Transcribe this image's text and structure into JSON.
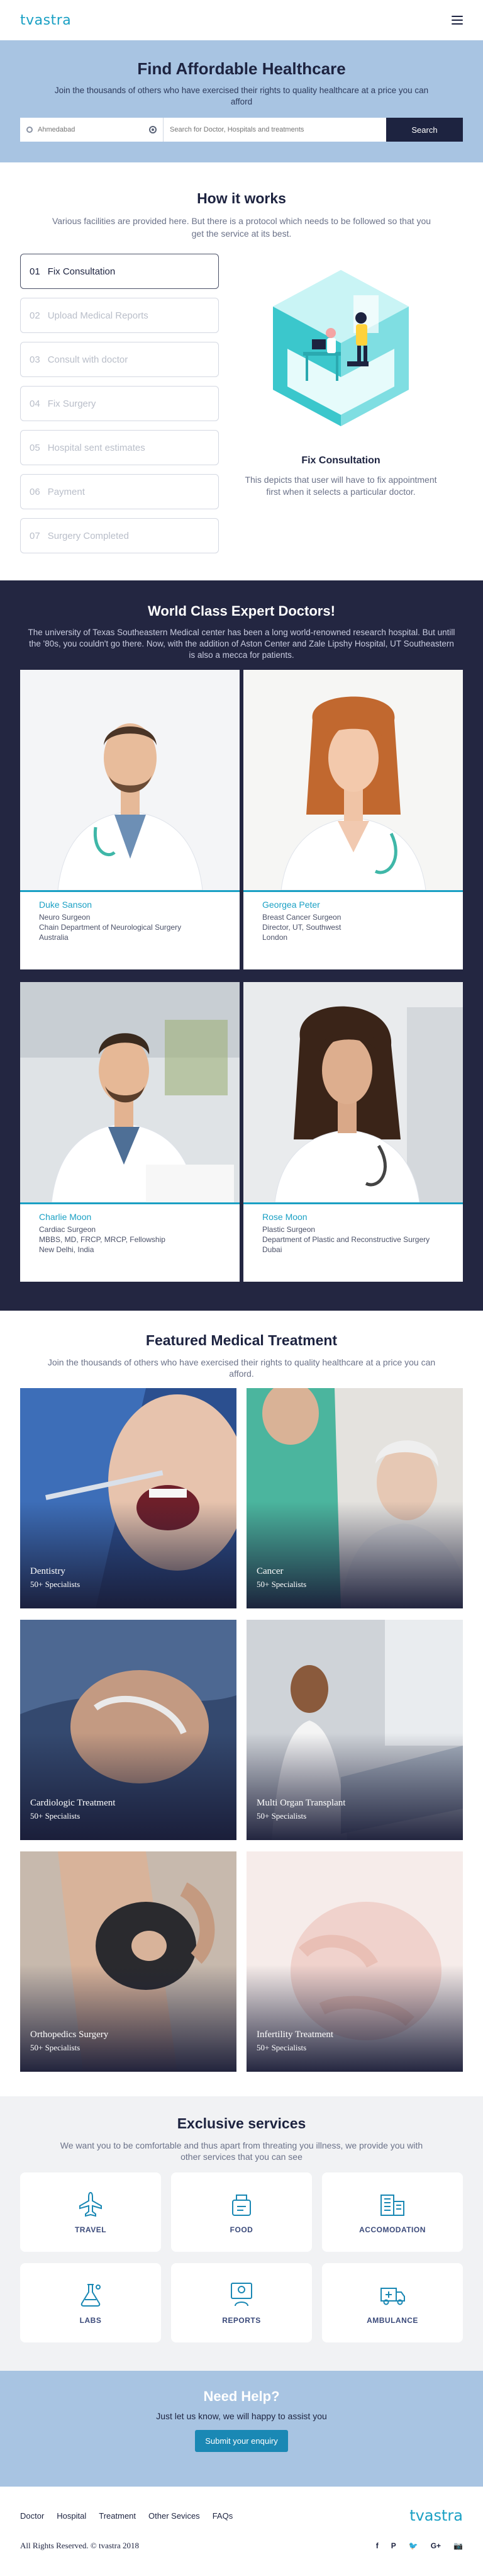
{
  "header": {
    "logo": "tvastra",
    "menu_icon": "hamburger-icon"
  },
  "hero": {
    "title": "Find Affordable Healthcare",
    "subtitle": "Join the thousands of others who have exercised their rights to quality healthcare at a price you can afford",
    "location_placeholder": "Ahmedabad",
    "search_placeholder": "Search for Doctor, Hospitals and treatments",
    "search_button": "Search"
  },
  "how": {
    "title": "How it works",
    "subtitle": "Various facilities are provided here. But there is a protocol which needs to be followed so that you get the service at its best.",
    "steps": [
      {
        "num": "01",
        "label": "Fix Consultation"
      },
      {
        "num": "02",
        "label": "Upload Medical Reports"
      },
      {
        "num": "03",
        "label": "Consult with doctor"
      },
      {
        "num": "04",
        "label": "Fix Surgery"
      },
      {
        "num": "05",
        "label": "Hospital sent estimates"
      },
      {
        "num": "06",
        "label": "Payment"
      },
      {
        "num": "07",
        "label": "Surgery Completed"
      }
    ],
    "active_step": 0,
    "detail_title": "Fix Consultation",
    "detail_text": "This depicts that user will have to fix appointment first when it selects a particular doctor."
  },
  "doctors": {
    "title": "World Class Expert Doctors!",
    "subtitle": "The university of Texas Southeastern Medical center has been a long world-renowned research hospital. But untill the '80s, you couldn't go there. Now, with the addition of Aston Center and Zale Lipshy Hospital, UT Southeastern is also a mecca for patients.",
    "list": [
      {
        "name": "Duke Sanson",
        "lines": [
          "Neuro Surgeon",
          "Chain Department of Neurological Surgery",
          "Australia"
        ]
      },
      {
        "name": "Georgea Peter",
        "lines": [
          "Breast Cancer Surgeon",
          "Director, UT, Southwest",
          "London"
        ]
      },
      {
        "name": "Charlie Moon",
        "lines": [
          "Cardiac Surgeon",
          "MBBS, MD, FRCP, MRCP, Fellowship",
          "New Delhi, India"
        ]
      },
      {
        "name": "Rose Moon",
        "lines": [
          "Plastic Surgeon",
          "Department of Plastic and Reconstructive Surgery",
          "Dubai"
        ]
      }
    ]
  },
  "treatment": {
    "title": "Featured Medical Treatment",
    "subtitle": "Join the thousands of others who have exercised their rights to quality healthcare at a price you can afford.",
    "cards": [
      {
        "name": "Dentistry",
        "count": "50+ Specialists"
      },
      {
        "name": "Cancer",
        "count": "50+ Specialists"
      },
      {
        "name": "Cardiologic Treatment",
        "count": "50+ Specialists"
      },
      {
        "name": "Multi Organ Transplant",
        "count": "50+ Specialists"
      },
      {
        "name": "Orthopedics Surgery",
        "count": "50+ Specialists"
      },
      {
        "name": "Infertility Treatment",
        "count": "50+ Specialists"
      }
    ]
  },
  "services": {
    "title": "Exclusive services",
    "subtitle": "We want you to be comfortable and thus apart from threating you illness, we provide you with other services that you can see",
    "items": [
      {
        "label": "TRAVEL",
        "icon": "airplane-icon"
      },
      {
        "label": "FOOD",
        "icon": "food-icon"
      },
      {
        "label": "ACCOMODATION",
        "icon": "building-icon"
      },
      {
        "label": "LABS",
        "icon": "flask-icon"
      },
      {
        "label": "REPORTS",
        "icon": "report-icon"
      },
      {
        "label": "AMBULANCE",
        "icon": "ambulance-icon"
      }
    ]
  },
  "help": {
    "title": "Need Help?",
    "text": "Just let us know, we will happy to assist you",
    "button": "Submit your enquiry"
  },
  "footer": {
    "links": [
      "Doctor",
      "Hospital",
      "Treatment",
      "Other Sevices",
      "FAQs"
    ],
    "logo": "tvastra",
    "copyright": "All Rights Reserved. © tvastra 2018",
    "socials": [
      "f",
      "P",
      "🐦",
      "G+",
      "📷"
    ]
  },
  "colors": {
    "accent": "#1aa0c4",
    "navy": "#1d2340",
    "hero_bg": "#a8c4e2"
  }
}
